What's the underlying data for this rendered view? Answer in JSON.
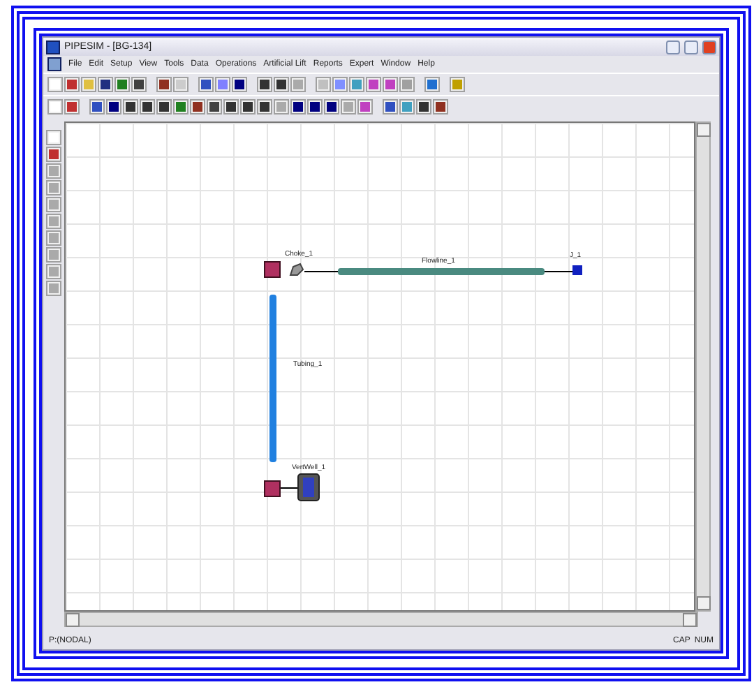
{
  "window": {
    "title": "PIPESIM - [BG-134]"
  },
  "menu": [
    "File",
    "Edit",
    "Setup",
    "View",
    "Tools",
    "Data",
    "Operations",
    "Artificial Lift",
    "Reports",
    "Expert",
    "Window",
    "Help"
  ],
  "diagram": {
    "choke": {
      "label": "Choke_1"
    },
    "flowline": {
      "label": "Flowline_1"
    },
    "junction": {
      "label": "J_1"
    },
    "tubing": {
      "label": "Tubing_1"
    },
    "well": {
      "label": "VertWell_1"
    }
  },
  "status_bar": {
    "mode": "P:(NODAL)",
    "indicators": [
      "CAP",
      "NUM"
    ]
  }
}
